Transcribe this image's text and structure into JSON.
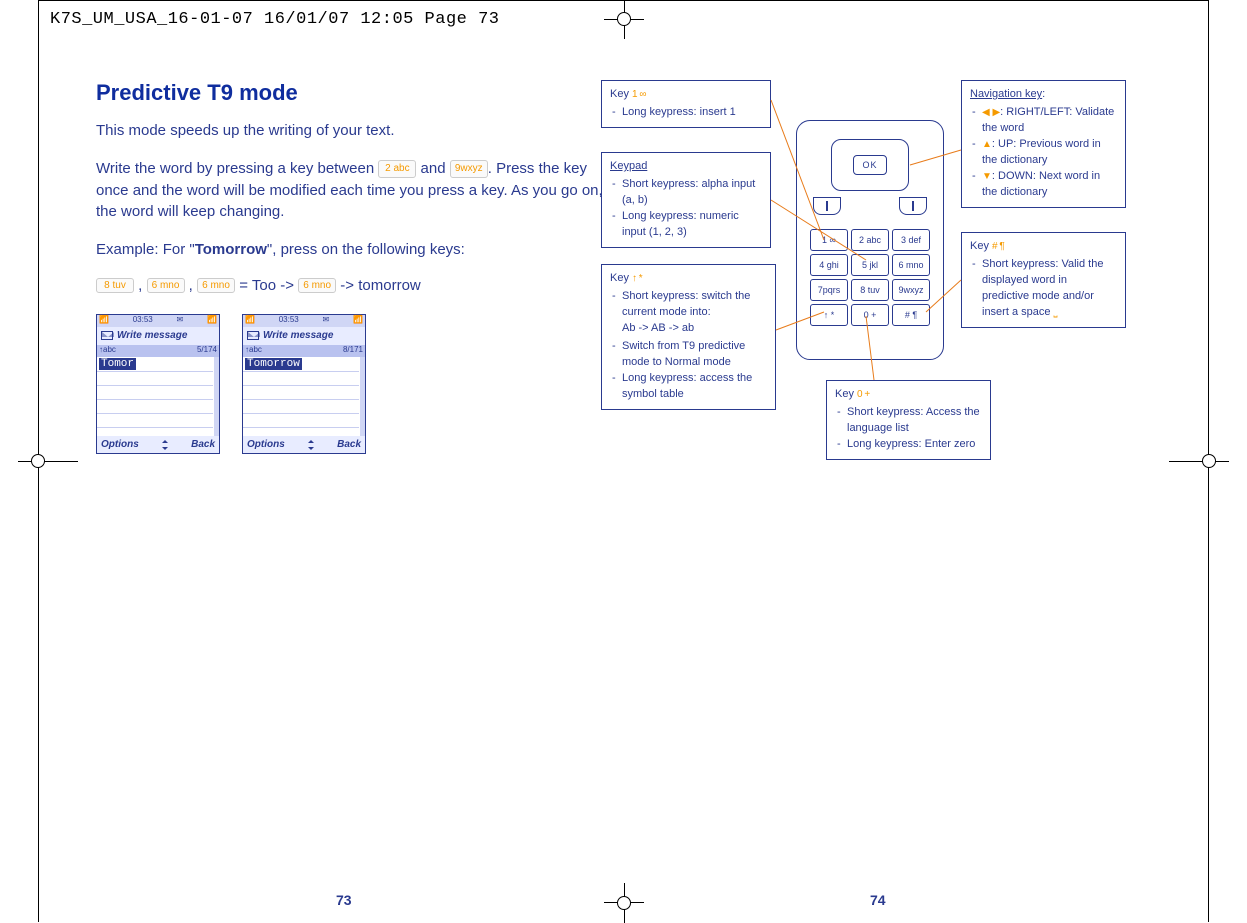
{
  "crop_info": "K7S_UM_USA_16-01-07  16/01/07  12:05  Page 73",
  "left": {
    "heading": "Predictive T9 mode",
    "p1": "This mode speeds up the writing of your text.",
    "p2a": "Write the word by pressing a key between ",
    "p2b": " and ",
    "p2c": ". Press the key once and the word will be modified each time you press a key. As you go on, the word will keep changing.",
    "p3a": "Example: For \"",
    "p3b": "Tomorrow",
    "p3c": "\", press on the following keys:",
    "seq_eq": " = Too -> ",
    "seq_end": " -> tomorrow",
    "key_2abc": "2 abc",
    "key_9wxyz": "9wxyz",
    "key_8tuv": "8 tuv",
    "key_6mno": "6 mno",
    "screen": {
      "time": "03:53",
      "title": "Write message",
      "mode_left": "abc",
      "counter": "5/174",
      "counter2": "8/171",
      "word1": "Tomor",
      "word2": "Tomorrow",
      "soft_left": "Options",
      "soft_right": "Back"
    }
  },
  "right": {
    "note_key1_title": "Key",
    "note_key1_glyph": "1 ∞",
    "note_key1_item": "Long keypress: insert 1",
    "note_keypad_title": "Keypad",
    "note_keypad_i1": "Short keypress: alpha input (a, b)",
    "note_keypad_i2": "Long keypress: numeric input (1, 2, 3)",
    "note_star_title": "Key",
    "note_star_glyph": "↑ *",
    "note_star_i1": "Short keypress: switch the current mode into:",
    "note_star_sub": "Ab -> AB -> ab",
    "note_star_i2": "Switch from T9 predictive mode to Normal mode",
    "note_star_i3": "Long keypress: access the symbol table",
    "note_zero_title": "Key",
    "note_zero_glyph": "0 +",
    "note_zero_i1": "Short keypress: Access the language list",
    "note_zero_i2": "Long keypress: Enter zero",
    "note_nav_title": "Navigation key",
    "note_nav_i1": ": RIGHT/LEFT: Validate the word",
    "note_nav_i2": ": UP: Previous word in the dictionary",
    "note_nav_i3": ": DOWN: Next word in the dictionary",
    "note_hash_title": "Key",
    "note_hash_glyph": "# ¶",
    "note_hash_i1": "Short keypress: Valid the displayed word in predictive mode and/or insert a space",
    "keypad": [
      "1 ∞",
      "2 abc",
      "3 def",
      "4 ghi",
      "5 jkl",
      "6 mno",
      "7pqrs",
      "8 tuv",
      "9wxyz",
      "↑ *",
      "0 +",
      "# ¶"
    ],
    "ok": "OK"
  },
  "page_left": "73",
  "page_right": "74"
}
